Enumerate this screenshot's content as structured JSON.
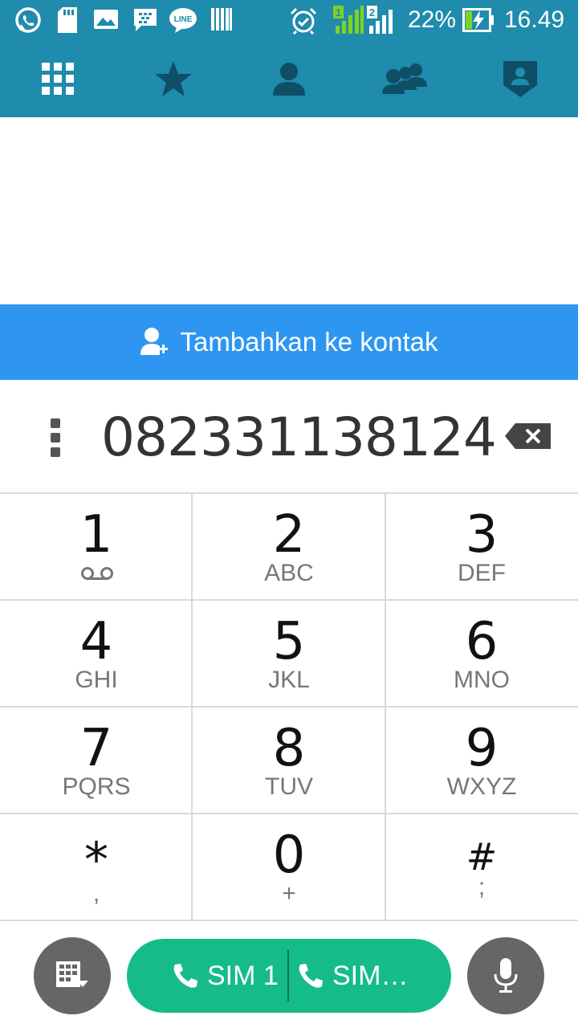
{
  "status_bar": {
    "battery": "22%",
    "time": "16.49",
    "sim1_label": "1",
    "sim2_label": "2",
    "line_label": "LINE",
    "icons": [
      "whatsapp-icon",
      "sd-card-icon",
      "image-icon",
      "bbm-icon",
      "line-icon",
      "barcode-icon",
      "alarm-icon",
      "sim1-signal-icon",
      "sim2-signal-icon",
      "battery-charging-icon"
    ]
  },
  "tabs": [
    {
      "name": "dialpad",
      "icon": "dialpad-icon"
    },
    {
      "name": "favorites",
      "icon": "star-icon"
    },
    {
      "name": "contacts",
      "icon": "person-icon"
    },
    {
      "name": "groups",
      "icon": "group-icon"
    },
    {
      "name": "security",
      "icon": "shield-person-icon"
    }
  ],
  "add_contact": {
    "label": "Tambahkan ke kontak",
    "icon": "add-person-icon"
  },
  "dialer": {
    "number": "082331138124"
  },
  "keys": [
    {
      "digit": "1",
      "letters": ""
    },
    {
      "digit": "2",
      "letters": "ABC"
    },
    {
      "digit": "3",
      "letters": "DEF"
    },
    {
      "digit": "4",
      "letters": "GHI"
    },
    {
      "digit": "5",
      "letters": "JKL"
    },
    {
      "digit": "6",
      "letters": "MNO"
    },
    {
      "digit": "7",
      "letters": "PQRS"
    },
    {
      "digit": "8",
      "letters": "TUV"
    },
    {
      "digit": "9",
      "letters": "WXYZ"
    },
    {
      "digit": "*",
      "letters": ","
    },
    {
      "digit": "0",
      "letters": "+"
    },
    {
      "digit": "#",
      "letters": ";"
    }
  ],
  "bottom": {
    "sim1_label": "SIM 1",
    "sim2_label": "SIM…"
  },
  "colors": {
    "header": "#1f8bad",
    "banner": "#2e96f0",
    "call": "#16bb8a",
    "round_button": "#666666"
  }
}
